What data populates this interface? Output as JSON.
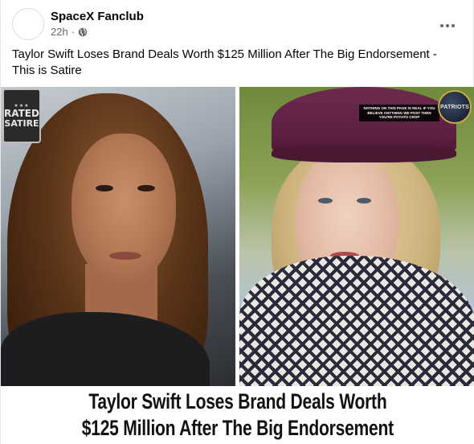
{
  "post": {
    "author": "SpaceX Fanclub",
    "time": "22h",
    "separator": "·",
    "privacy_icon": "globe-icon",
    "more_icon": "more-options-icon",
    "caption": "Taylor Swift Loses Brand Deals Worth $125 Million After The Big Endorsement - This is Satire"
  },
  "image": {
    "badge": {
      "line1": "RATED",
      "line2": "SATIRE",
      "stars": "★★★"
    },
    "disclaimer": "NOTHING ON THIS PAGE IS REAL IF YOU BELIEVE ANYTHING WE POST THEN YOU'RE POTATO CROP",
    "patriots_logo": "PATRIOTS",
    "headline_line1": "Taylor Swift Loses Brand Deals Worth",
    "headline_line2": "$125 Million After The Big Endorsement"
  },
  "colors": {
    "text_primary": "#050505",
    "text_secondary": "#65676b",
    "hat": "#6d2a4f"
  }
}
